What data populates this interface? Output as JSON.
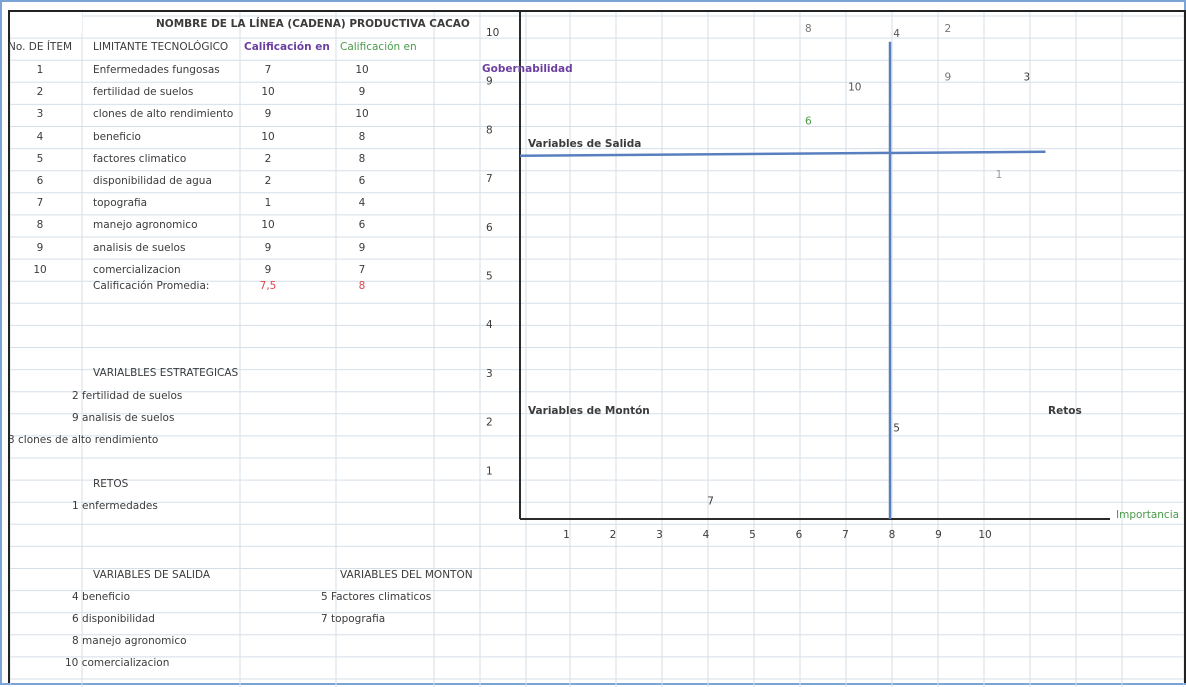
{
  "page": {
    "title": "NOMBRE DE LA LÍNEA (CADENA) PRODUCTIVA  CACAO"
  },
  "colors": {
    "frame_blue": "#7aa4d6",
    "grid": "#d6dfe9",
    "axis": "#2b2b2b",
    "quadrant_line": "#5a7fbf",
    "purple": "#6b3fa0",
    "green": "#4a9a4a",
    "red": "#e0444c"
  },
  "table": {
    "col_headers": {
      "item": "No. DE ÍTEM",
      "limitante": "LIMITANTE TECNOLÓGICO",
      "cal1": "Calificación en",
      "cal2": "Calificación en"
    },
    "rows": [
      {
        "item": "1",
        "name": "Enfermedades fungosas",
        "v1": "7",
        "v2": "10"
      },
      {
        "item": "2",
        "name": "fertilidad de suelos",
        "v1": "10",
        "v2": "9"
      },
      {
        "item": "3",
        "name": "clones de alto rendimiento",
        "v1": "9",
        "v2": "10"
      },
      {
        "item": "4",
        "name": "beneficio",
        "v1": "10",
        "v2": "8"
      },
      {
        "item": "5",
        "name": "factores climatico",
        "v1": "2",
        "v2": "8"
      },
      {
        "item": "6",
        "name": "disponibilidad de agua",
        "v1": "2",
        "v2": "6"
      },
      {
        "item": "7",
        "name": "topografia",
        "v1": "1",
        "v2": "4"
      },
      {
        "item": "8",
        "name": "manejo agronomico",
        "v1": "10",
        "v2": "6"
      },
      {
        "item": "9",
        "name": "analisis de suelos",
        "v1": "9",
        "v2": "9"
      },
      {
        "item": "10",
        "name": "comercializacion",
        "v1": "9",
        "v2": "7"
      }
    ],
    "avg_label": "Calificación Promedia:",
    "avg1": "7,5",
    "avg2": "8"
  },
  "lists": {
    "estrategicas": {
      "title": "VARIALBLES ESTRATEGICAS",
      "items": [
        {
          "num": "2",
          "text": "fertilidad de suelos"
        },
        {
          "num": "9",
          "text": "analisis de suelos"
        }
      ],
      "extra": "3 clones de alto rendimiento"
    },
    "retos": {
      "title": "RETOS",
      "items": [
        {
          "num": "1",
          "text": "enfermedades"
        }
      ]
    },
    "salida": {
      "title": "VARIABLES DE SALIDA",
      "items": [
        {
          "num": "4",
          "text": "beneficio"
        },
        {
          "num": "6",
          "text": "disponibilidad"
        },
        {
          "num": "8",
          "text": "manejo agronomico"
        },
        {
          "num": "10",
          "text": "comercializacion"
        }
      ]
    },
    "monton": {
      "title": "VARIABLES DEL MONTON",
      "items": [
        {
          "num": "5",
          "text": "Factores climaticos"
        },
        {
          "num": "7",
          "text": "topografia"
        }
      ]
    }
  },
  "chart_data": {
    "type": "scatter",
    "ylabel": "Gobernabilidad",
    "xlabel": "Importancia",
    "x_ticks": [
      "1",
      "2",
      "3",
      "4",
      "5",
      "6",
      "7",
      "8",
      "9",
      "10"
    ],
    "y_ticks": [
      "1",
      "2",
      "3",
      "4",
      "5",
      "6",
      "7",
      "8",
      "9",
      "10"
    ],
    "xlim": [
      0,
      10
    ],
    "ylim": [
      0,
      10
    ],
    "grid": true,
    "quadrant_lines": {
      "x": 8,
      "y": 7.5
    },
    "quadrants": {
      "top_left": "Variables de Salida",
      "bottom_left": "Variables de Montón",
      "bottom_right": "Retos"
    },
    "points": [
      {
        "label": "8",
        "x": 6.2,
        "y": 10
      },
      {
        "label": "4",
        "x": 8.1,
        "y": 9.9
      },
      {
        "label": "2",
        "x": 9.2,
        "y": 10
      },
      {
        "label": "9",
        "x": 9.2,
        "y": 9
      },
      {
        "label": "3",
        "x": 10.9,
        "y": 9
      },
      {
        "label": "10",
        "x": 7.2,
        "y": 8.8
      },
      {
        "label": "6",
        "x": 6.2,
        "y": 8.1
      },
      {
        "label": "1",
        "x": 10.3,
        "y": 7
      },
      {
        "label": "5",
        "x": 8.1,
        "y": 1.8
      },
      {
        "label": "7",
        "x": 4.1,
        "y": 0.3
      }
    ]
  }
}
